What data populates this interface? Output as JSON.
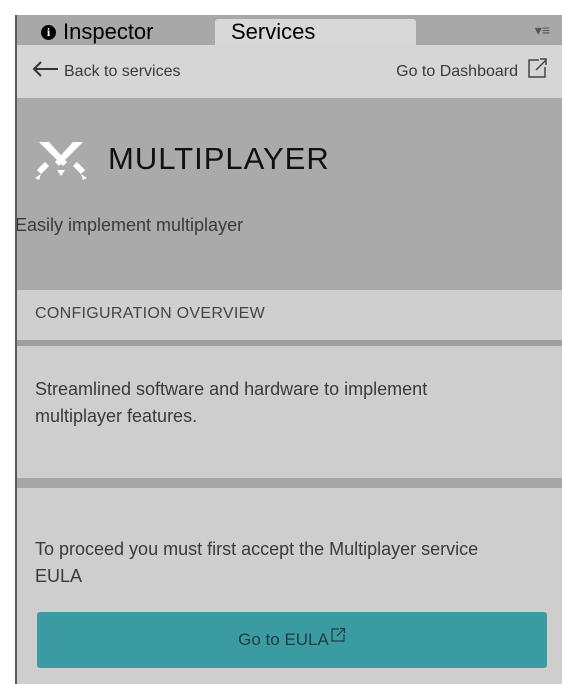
{
  "tabs": [
    {
      "label": "Inspector",
      "icon": "info-icon"
    },
    {
      "label": "Services",
      "active": true
    }
  ],
  "tab_menu": {
    "icon": "tab-menu-icon",
    "glyph": "▾≡"
  },
  "nav": {
    "back_label": "Back to services",
    "dashboard_label": "Go to Dashboard"
  },
  "header": {
    "icon": "multiplayer-icon",
    "title": "MULTIPLAYER",
    "subtitle": "Easily implement multiplayer"
  },
  "section": {
    "heading": "CONFIGURATION OVERVIEW",
    "description": "Streamlined software and hardware to implement multiplayer features."
  },
  "eula": {
    "notice": "To proceed you must first accept the Multiplayer service EULA",
    "button_label": "Go to EULA"
  },
  "colors": {
    "accent": "#3b9ba3",
    "header_bg": "#aaaaaa",
    "panel_bg": "#cecece"
  }
}
